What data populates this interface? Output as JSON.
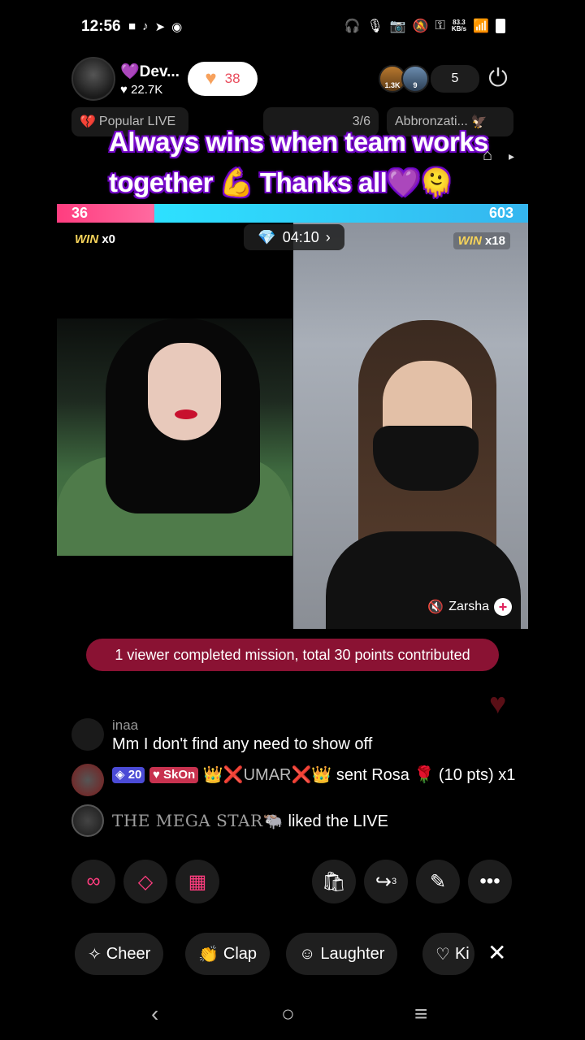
{
  "status_bar": {
    "time": "12:56",
    "left_icons": [
      "video-icon",
      "tiktok-icon",
      "telegram-icon",
      "circle-icon"
    ],
    "net_speed_value": "83.3",
    "net_speed_unit": "KB/s"
  },
  "host": {
    "name": "💜Dev...",
    "likes": "22.7K",
    "follow_count": "38"
  },
  "viewers": {
    "avatar1_badge": "1.3K",
    "avatar2_badge": "9",
    "count": "5"
  },
  "chips": {
    "popular": "Popular LIVE",
    "progress": "3/6",
    "third": "Abbronzati..."
  },
  "caption": "Always wins when team works together 💪 Thanks all💜🫠",
  "battle": {
    "score_left": "36",
    "score_right": "603",
    "score_left_fraction": 0.056,
    "timer": "04:10",
    "win_label": "WIN",
    "left_wins": "x0",
    "right_wins": "x18",
    "guest_name": "Zarsha"
  },
  "mission_banner": "1 viewer completed mission, total 30 points contributed",
  "chat": [
    {
      "user": "inaa",
      "text": "Mm I don't find any need to show off"
    },
    {
      "level": "20",
      "fan_badge": "SkOn",
      "sender": "👑❌UMAR❌👑",
      "text": "sent Rosa 🌹 (10 pts) x1"
    },
    {
      "user": "THE MEGA STAR🐃",
      "text": "liked the LIVE"
    }
  ],
  "reactions": {
    "cheer": "Cheer",
    "clap": "Clap",
    "laughter": "Laughter",
    "kiss": "Ki"
  },
  "share_count": "3",
  "colors": {
    "left_score": "#ff3d7f",
    "right_score": "#2de1ff",
    "mission_bg": "#8a1233",
    "win_gold": "#f6d35a"
  }
}
